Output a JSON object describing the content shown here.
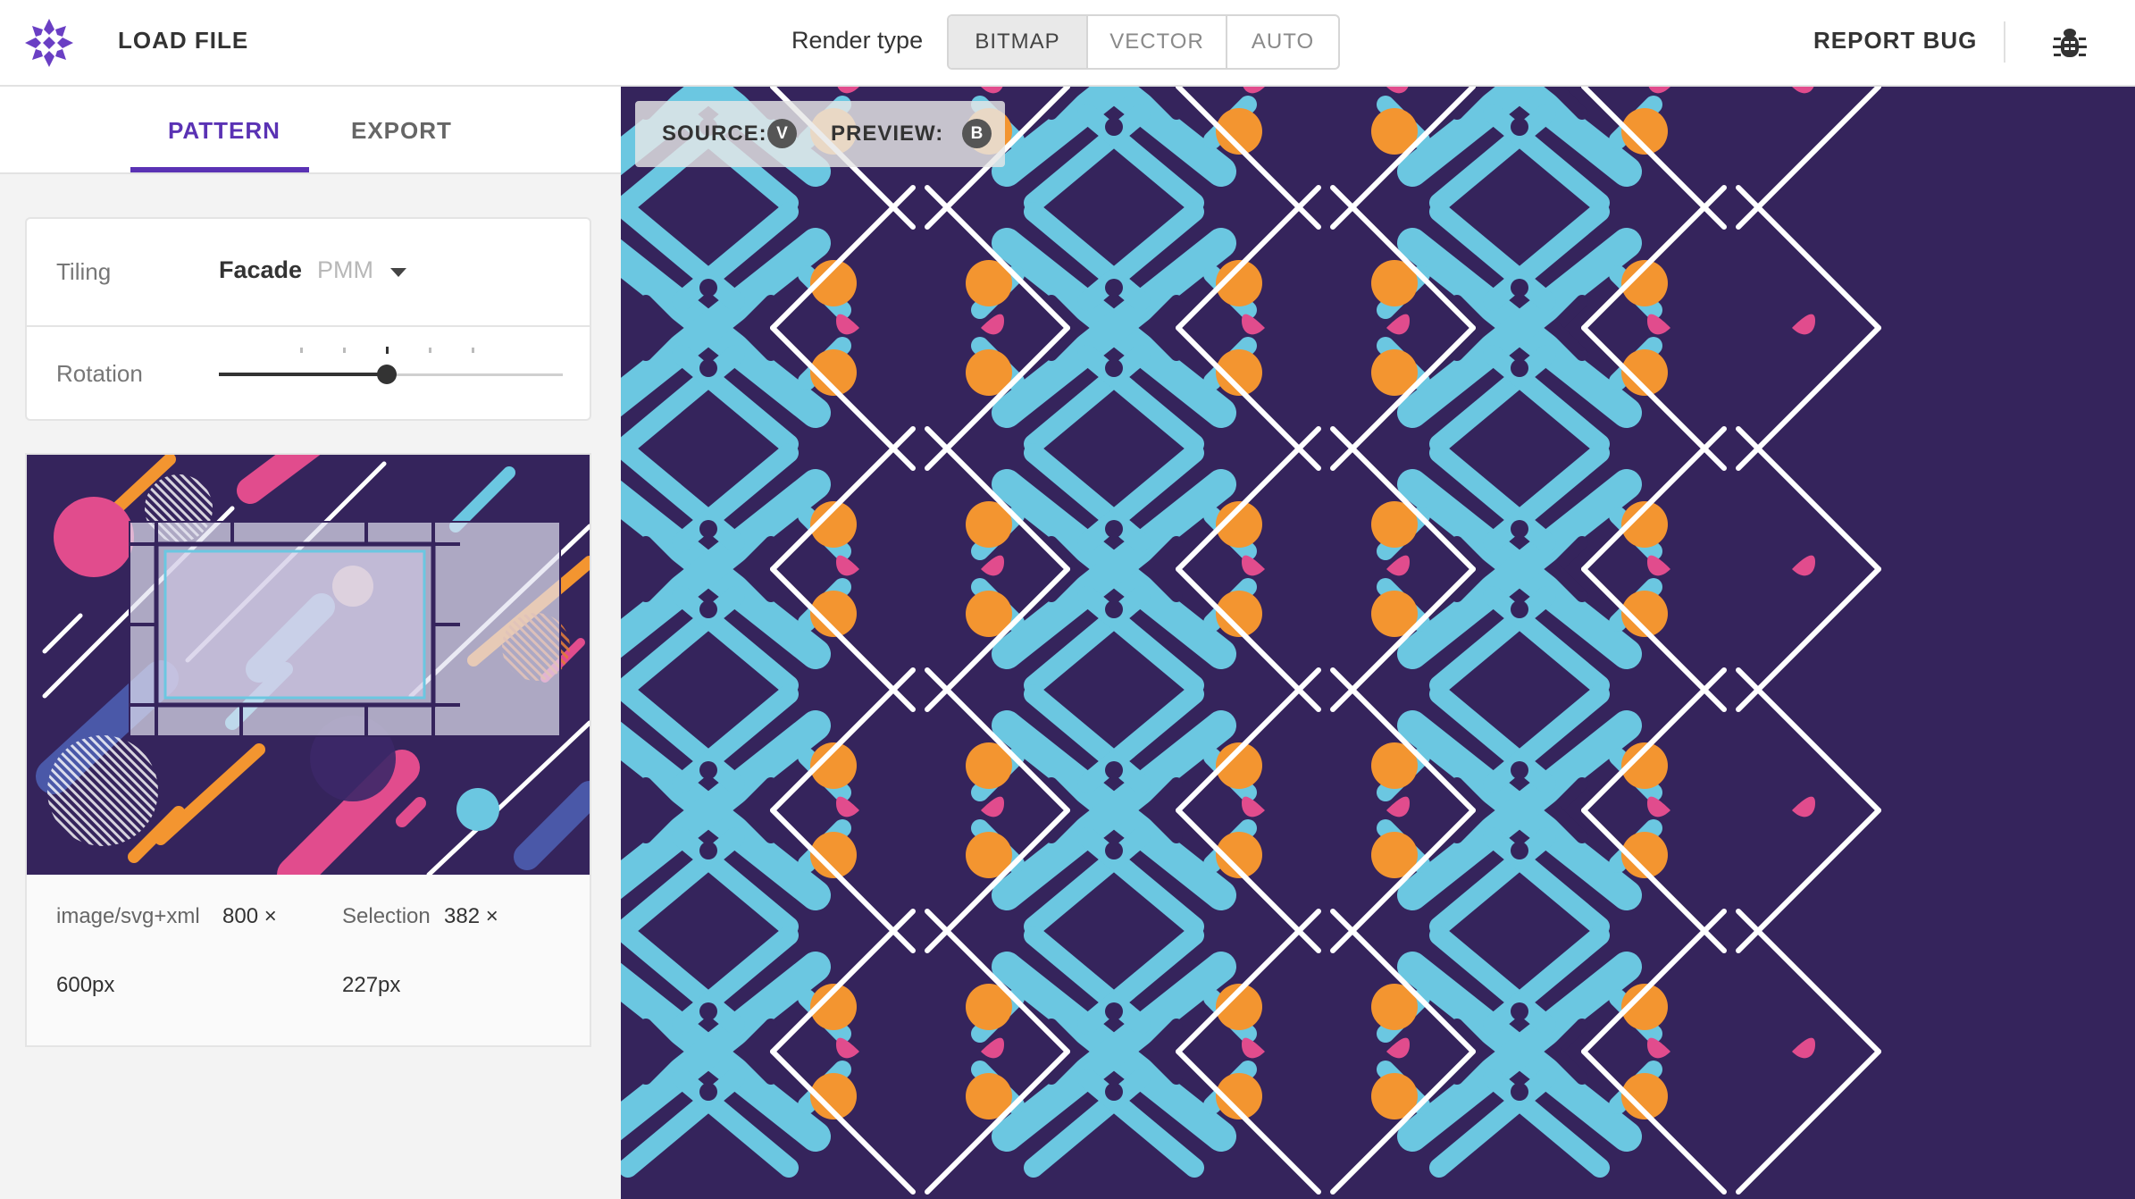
{
  "app": {
    "load_file": "LOAD FILE",
    "render_type_label": "Render type",
    "render_types": [
      "BITMAP",
      "VECTOR",
      "AUTO"
    ],
    "render_type_selected": "BITMAP",
    "report_bug": "REPORT BUG",
    "brand_color": "#5a32b4"
  },
  "sidebar": {
    "tabs": [
      "PATTERN",
      "EXPORT"
    ],
    "active_tab": "PATTERN",
    "tiling": {
      "label": "Tiling",
      "value": "Facade",
      "group": "PMM"
    },
    "rotation": {
      "label": "Rotation",
      "steps": 5,
      "selected_step": 3,
      "level": 0.5
    },
    "source_info": {
      "mime_label": "image/svg+xml",
      "size_a": "800 ×",
      "size_b": "600px",
      "selection_label": "Selection",
      "sel_a": "382 ×",
      "sel_b": "227px"
    }
  },
  "canvas": {
    "source_label": "SOURCE:",
    "source_key": "V",
    "preview_label": "PREVIEW:",
    "preview_key": "B",
    "colors": {
      "background": "#35245c",
      "cyan": "#6bc7e1",
      "orange": "#f39530",
      "pink": "#e14c8d",
      "white": "#ffffff"
    }
  },
  "icons": {
    "logo": "logo-icon",
    "bug": "bug-icon",
    "dropdown": "caret-down-icon"
  }
}
